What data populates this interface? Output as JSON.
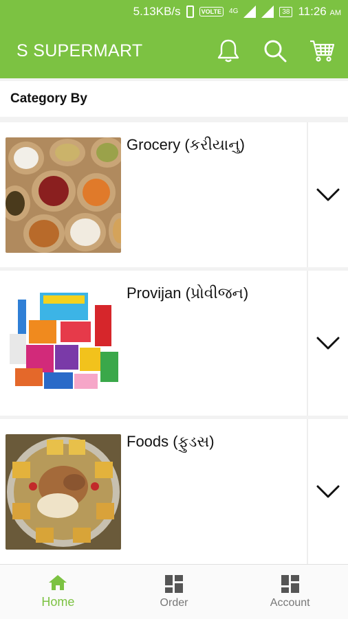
{
  "status_bar": {
    "speed": "5.13KB/s",
    "volte": "VOLTE",
    "network": "4G",
    "battery": "38",
    "time": "11:26",
    "ampm": "AM"
  },
  "app_bar": {
    "title": "S SUPERMART",
    "icons": [
      "bell-icon",
      "search-icon",
      "cart-icon"
    ]
  },
  "category_header": "Category By",
  "categories": [
    {
      "label": "Grocery (કરીયાનુ)",
      "image": "grocery-sacks-image"
    },
    {
      "label": "Provijan (પ્રોવીજન)",
      "image": "provision-products-image"
    },
    {
      "label": "Foods (ફુડસ)",
      "image": "dry-fruits-image"
    }
  ],
  "bottom_nav": [
    {
      "label": "Home",
      "icon": "home-icon",
      "active": true
    },
    {
      "label": "Order",
      "icon": "grid-icon",
      "active": false
    },
    {
      "label": "Account",
      "icon": "grid-icon",
      "active": false
    }
  ],
  "colors": {
    "primary": "#7cc242",
    "text": "#111111",
    "inactive": "#777777"
  }
}
